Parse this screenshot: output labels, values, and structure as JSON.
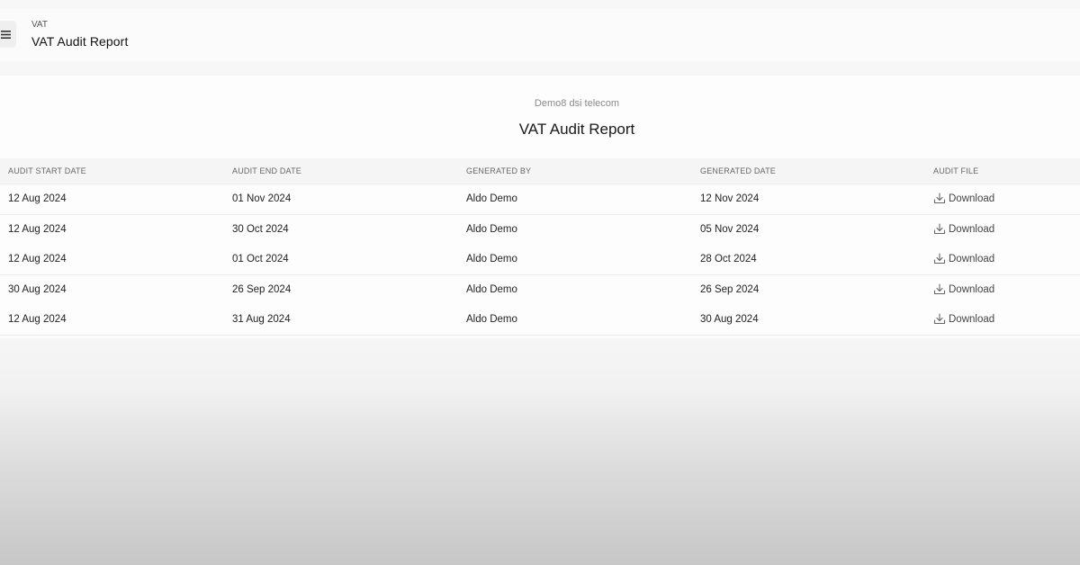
{
  "header": {
    "breadcrumb": "VAT",
    "title": "VAT Audit Report"
  },
  "report": {
    "company": "Demo8 dsi telecom",
    "title": "VAT Audit Report"
  },
  "table": {
    "columns": [
      "AUDIT START DATE",
      "AUDIT END DATE",
      "GENERATED BY",
      "GENERATED DATE",
      "AUDIT FILE"
    ],
    "rows": [
      {
        "start": "12 Aug 2024",
        "end": "01 Nov 2024",
        "by": "Aldo Demo",
        "generated": "12 Nov 2024",
        "file": "Download"
      },
      {
        "start": "12 Aug 2024",
        "end": "30 Oct 2024",
        "by": "Aldo Demo",
        "generated": "05 Nov 2024",
        "file": "Download"
      },
      {
        "start": "12 Aug 2024",
        "end": "01 Oct 2024",
        "by": "Aldo Demo",
        "generated": "28 Oct 2024",
        "file": "Download"
      },
      {
        "start": "30 Aug 2024",
        "end": "26 Sep 2024",
        "by": "Aldo Demo",
        "generated": "26 Sep 2024",
        "file": "Download"
      },
      {
        "start": "12 Aug 2024",
        "end": "31 Aug 2024",
        "by": "Aldo Demo",
        "generated": "30 Aug 2024",
        "file": "Download"
      }
    ]
  },
  "icons": {
    "menu": "menu-icon",
    "download": "download-icon"
  }
}
